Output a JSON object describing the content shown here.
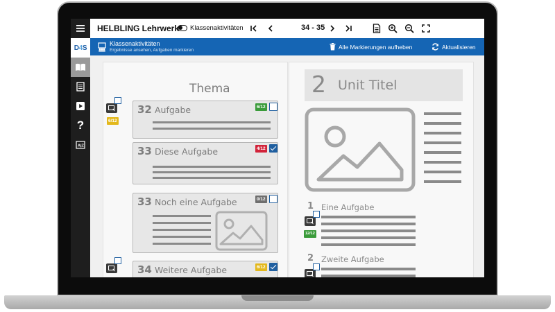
{
  "app": {
    "title": "HELBLING Lehrwerk",
    "mode_label": "Klassenaktivitäten",
    "page_range": "34 - 35"
  },
  "sidebar": {
    "logo": {
      "d": "D",
      "n": "4",
      "s": "S"
    },
    "items": [
      {
        "name": "menu",
        "icon": "hamburger-icon"
      },
      {
        "name": "logo",
        "icon": "d4s-logo"
      },
      {
        "name": "book",
        "icon": "book-icon",
        "active": true
      },
      {
        "name": "worksheet",
        "icon": "worksheet-icon"
      },
      {
        "name": "media",
        "icon": "play-icon"
      },
      {
        "name": "help",
        "icon": "help-icon",
        "label": "?"
      },
      {
        "name": "glossary",
        "icon": "glossary-icon"
      }
    ]
  },
  "bluebar": {
    "title": "Klassenaktivitäten",
    "subtitle": "Ergebnisse ansehen, Aufgaben markieren",
    "clear_label": "Alle Markierungen aufheben",
    "refresh_label": "Aktualisieren"
  },
  "left_page": {
    "heading": "Thema",
    "tasks": [
      {
        "number": "32",
        "name": "Aufgabe",
        "score": "6/12",
        "score_color": "#3a9b3a",
        "checked": false,
        "side_score": "6/12",
        "side_color": "#e3b81c"
      },
      {
        "number": "33",
        "name": "Diese Aufgabe",
        "score": "4/12",
        "score_color": "#d2233a",
        "checked": true
      },
      {
        "number": "33",
        "name": "Noch eine Aufgabe",
        "score": "0/12",
        "score_color": "#6e6e6e",
        "checked": false
      },
      {
        "number": "34",
        "name": "Weitere Aufgabe",
        "score": "6/12",
        "score_color": "#e3b81c",
        "checked": true
      }
    ]
  },
  "right_page": {
    "unit_number": "2",
    "unit_title": "Unit Titel",
    "subtasks": [
      {
        "number": "1",
        "name": "Eine Aufgabe",
        "score": "12/12",
        "score_color": "#3a9b3a"
      },
      {
        "number": "2",
        "name": "Zweite Aufgabe"
      }
    ]
  },
  "colors": {
    "accent": "#1565b4",
    "sidebar": "#1e1e1e",
    "placeholder_gray": "#8a8a8a"
  }
}
